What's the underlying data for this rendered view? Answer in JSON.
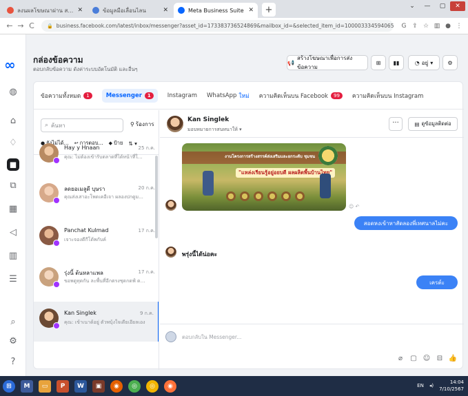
{
  "browser": {
    "tabs": [
      {
        "label": "ลงนผลโฆษณาผ่าน สาเกิดมรว.ปิว",
        "active": false,
        "color": "#e8533e"
      },
      {
        "label": "ข้อมูลมือเลื่อนไลน",
        "active": false,
        "color": "#4a7dd9"
      },
      {
        "label": "Meta Business Suite",
        "active": true,
        "color": "#0866ff"
      }
    ],
    "new_tab": "+",
    "url": "business.facebook.com/latest/inbox/messenger?asset_id=173383736524869&mailbox_id=&selected_item_id=100003334594065&thread_type=FB_MESSAGE"
  },
  "nav": {
    "icons": [
      "meta-logo-icon",
      "business-avatar-icon",
      "home-icon",
      "notification-icon",
      "inbox-icon",
      "content-icon",
      "calendar-icon",
      "ads-icon",
      "insights-icon",
      "menu-icon",
      "search-icon",
      "settings-icon",
      "help-icon"
    ]
  },
  "header": {
    "title": "กล่องข้อความ",
    "subtitle": "ตอบกลับข้อความ ดังค่าระบบอัตโนมัติ และอื่นๆ",
    "create_ad_label": "สร้างโฆษณาเพื่อการส่งข้อความ",
    "account_label": "อยู่"
  },
  "tabs": [
    {
      "label": "ข้อความทั้งหมด",
      "badge": "1",
      "active": false
    },
    {
      "label": "Messenger",
      "badge": "1",
      "active": true
    },
    {
      "label": "Instagram",
      "badge": "",
      "active": false
    },
    {
      "label": "WhatsApp",
      "badge": "",
      "active": false,
      "new": "ใหม่"
    },
    {
      "label": "ความคิดเห็นบน Facebook",
      "badge": "99",
      "active": false
    },
    {
      "label": "ความคิดเห็นบน Instagram",
      "badge": "",
      "active": false
    }
  ],
  "list": {
    "search_placeholder": "ค้นหา",
    "filter_label": "ร้องการ",
    "chips": [
      "ยังไม่ได้...",
      "การตอบ...",
      "ป้าย",
      "⇅ ▾"
    ],
    "conversations": [
      {
        "name": "Hay y Hnaan",
        "preview": "คุณ: ไม่ต้องเข้ารับตลาดที่ได้หน้าที่ให้ไปรับ...",
        "date": "25 ก.ค.",
        "avatar": "#b88a62",
        "selected": false
      },
      {
        "name": "ลดยอเมลูดี บุษรา",
        "preview": "คุณส่งเสาอะโพดเคอีเจา ผลองปกดูม...",
        "date": "20 ก.ค.",
        "avatar": "#d7a98a",
        "selected": false
      },
      {
        "name": "Panchat Kulmad",
        "preview": "เจาะจองตีกีโต้พกับค์",
        "date": "17 ก.ค.",
        "avatar": "#8a5a44",
        "selected": false
      },
      {
        "name": "รุ่งนี้ ต้นหลาแพล",
        "preview": "ขอพดูทุดกัน ละพื้นที่อีกตรงชุดกดฟ์ ดา..",
        "date": "17 ก.ค.",
        "avatar": "#c9a27e",
        "selected": false
      },
      {
        "name": "Kan Singlek",
        "preview": "คุณ: เข้าเนาด้อยู่ ตัวพบุ้งใจเดียเอียลเอง",
        "date": "9 ก.ค.",
        "avatar": "#6b4a34",
        "selected": true
      }
    ]
  },
  "chat": {
    "name": "Kan Singlek",
    "status": "มอบหมายการสนทนาให้",
    "more": "···",
    "profile_btn": "ดูข้อมูลติดต่อ",
    "poster_title": "งานโครงการสร้างสรรค์ส่งเสริมและยกระดับ ชุมชน",
    "poster_banner": "\"แหล่งเรียนรู้อยู่อยบดี ผลผลิตพื้นบ้านไทย\"",
    "messages": [
      {
        "dir": "out",
        "text": "สอดหงเข้าหาสัดลองพี่เทศนาลไม่คะ"
      },
      {
        "dir": "in",
        "text": "พรุ่งนี้ได้น่อคะ"
      },
      {
        "dir": "out",
        "text": "เครต์ะ"
      }
    ],
    "composer_placeholder": "ตอบกลับใน Messenger...",
    "tools": [
      "attach-icon",
      "sticker-icon",
      "emoji-icon",
      "shop-icon",
      "like-icon"
    ]
  },
  "taskbar": {
    "apps": [
      "windows-icon",
      "mail-icon",
      "explorer-icon",
      "powerpoint-icon",
      "word-icon",
      "app-icon",
      "firefox-icon",
      "chrome-icon",
      "chrome-alt-icon",
      "firefox-alt-icon"
    ],
    "lang": "EN",
    "time": "14:04",
    "date": "7/10/2567"
  }
}
